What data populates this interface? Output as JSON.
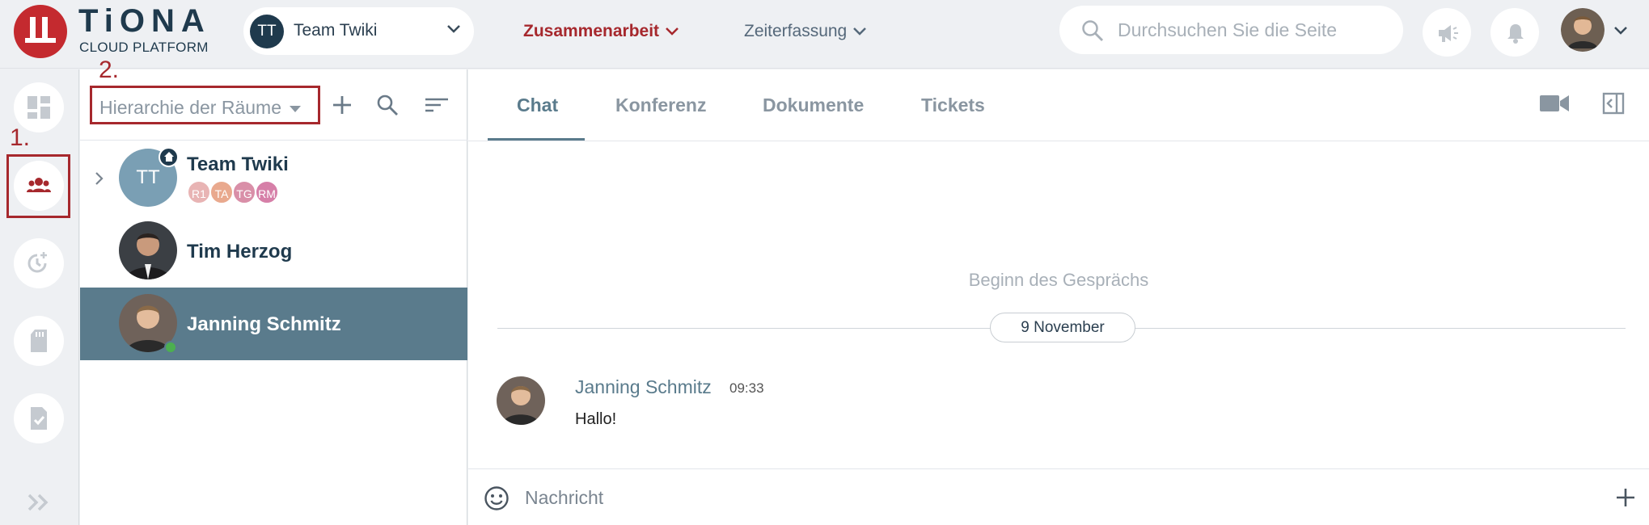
{
  "brand": {
    "title": "TiONA",
    "subtitle": "CLOUD PLATFORM"
  },
  "team_selector": {
    "initials": "TT",
    "name": "Team Twiki"
  },
  "main_menu": {
    "collaboration": "Zusammenarbeit",
    "time_tracking": "Zeiterfassung"
  },
  "search": {
    "placeholder": "Durchsuchen Sie die Seite"
  },
  "annotations": {
    "one": "1.",
    "two": "2."
  },
  "rooms_panel": {
    "hierarchy_select": "Hierarchie der Räume",
    "rooms": [
      {
        "name": "Team Twiki",
        "initials": "TT",
        "members": [
          "R1",
          "TA",
          "TG",
          "RM"
        ]
      },
      {
        "name": "Tim Herzog"
      },
      {
        "name": "Janning Schmitz",
        "status": "online"
      }
    ]
  },
  "chat": {
    "tabs": [
      "Chat",
      "Konferenz",
      "Dokumente",
      "Tickets"
    ],
    "active_tab": "Chat",
    "begin_text": "Beginn des Gesprächs",
    "date_divider": "9 November",
    "messages": [
      {
        "author": "Janning Schmitz",
        "time": "09:33",
        "text": "Hallo!"
      }
    ],
    "composer_placeholder": "Nachricht"
  },
  "colors": {
    "brand_red": "#c42a2f",
    "navy": "#1f3a4d",
    "selected_row": "#5a7b8c",
    "online": "#4caf50"
  }
}
